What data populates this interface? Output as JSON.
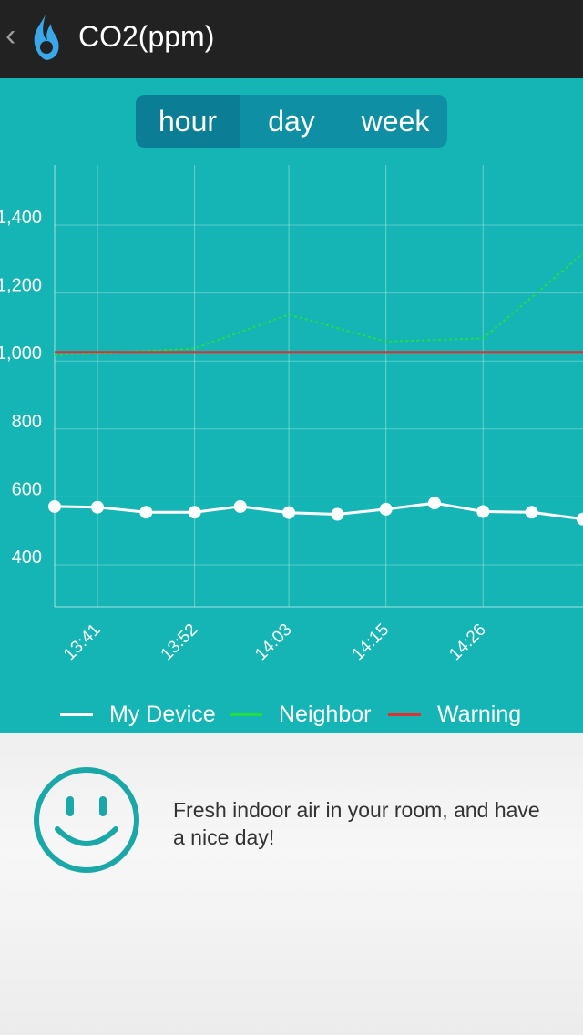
{
  "header": {
    "back_icon": "chevron-left-icon",
    "app_icon": "flame-icon",
    "title": "CO2(ppm)"
  },
  "tabs": [
    {
      "label": "hour",
      "active": true
    },
    {
      "label": "day",
      "active": false
    },
    {
      "label": "week",
      "active": false
    }
  ],
  "chart_data": {
    "type": "line",
    "x": [
      "13:41",
      "13:52",
      "14:03",
      "14:15",
      "14:26"
    ],
    "y_ticks": [
      "1,400",
      "1,200",
      "1,000",
      "800",
      "600",
      "400"
    ],
    "series": [
      {
        "name": "My Device",
        "color": "#ffffff",
        "points": [
          [
            13.35,
            545
          ],
          [
            13.5,
            543
          ],
          [
            13.67,
            528
          ],
          [
            13.84,
            528
          ],
          [
            14.0,
            545
          ],
          [
            14.17,
            527
          ],
          [
            14.34,
            522
          ],
          [
            14.51,
            537
          ],
          [
            14.68,
            555
          ],
          [
            14.85,
            530
          ],
          [
            15.02,
            528
          ],
          [
            15.2,
            508
          ]
        ]
      },
      {
        "name": "Neighbor",
        "color": "#22dd44",
        "dashed": true,
        "points": [
          [
            13.35,
            990
          ],
          [
            13.6,
            1000
          ],
          [
            13.84,
            1010
          ],
          [
            14.17,
            1110
          ],
          [
            14.51,
            1030
          ],
          [
            14.85,
            1040
          ],
          [
            15.02,
            1160
          ],
          [
            15.2,
            1290
          ]
        ]
      },
      {
        "name": "Warning",
        "color": "#e03030",
        "points": [
          [
            13.35,
            1000
          ],
          [
            15.2,
            1000
          ]
        ]
      }
    ],
    "grid": true
  },
  "legend": [
    {
      "label": "My Device",
      "color": "#ffffff"
    },
    {
      "label": "Neighbor",
      "color": "#22dd44"
    },
    {
      "label": "Warning",
      "color": "#e03030"
    }
  ],
  "status": {
    "face_icon": "smiley-face-icon",
    "message": "Fresh indoor air in your room, and have a nice day!"
  }
}
